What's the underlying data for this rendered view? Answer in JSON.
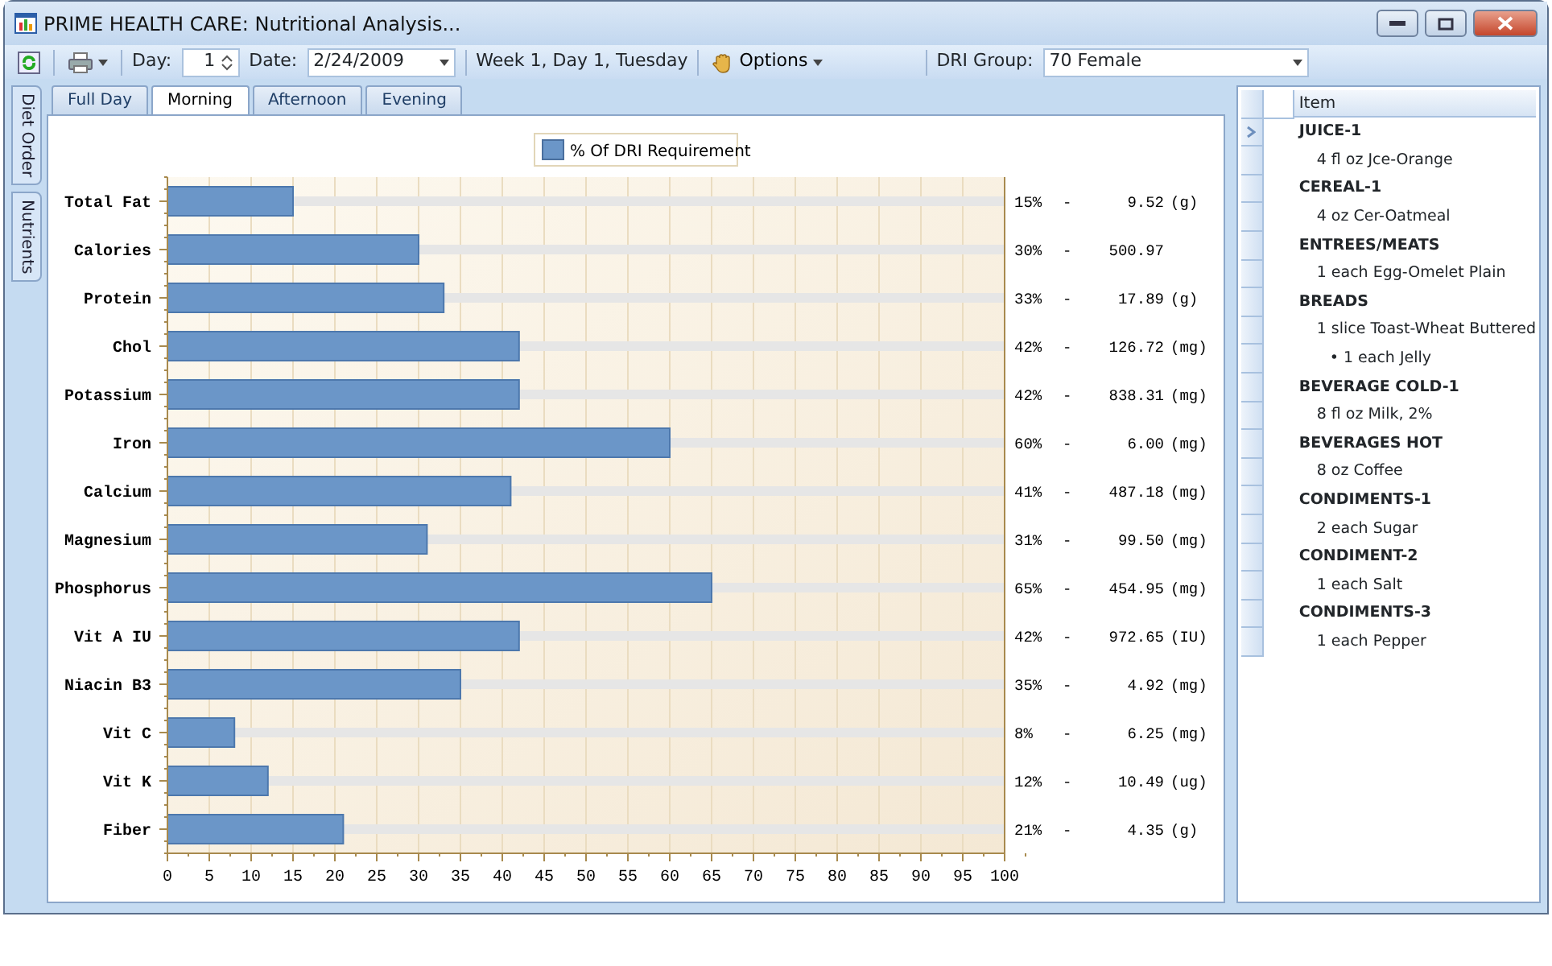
{
  "window": {
    "title": "PRIME HEALTH CARE: Nutritional Analysis..."
  },
  "toolbar": {
    "day_label": "Day:",
    "day_value": "1",
    "date_label": "Date:",
    "date_value": "2/24/2009",
    "week_text": "Week 1, Day 1, Tuesday",
    "options_label": "Options",
    "dri_label": "DRI Group:",
    "dri_value": "70 Female"
  },
  "side_tabs": [
    {
      "label": "Diet Order"
    },
    {
      "label": "Nutrients"
    }
  ],
  "tabs": [
    {
      "label": "Full Day",
      "selected": false
    },
    {
      "label": "Morning",
      "selected": true
    },
    {
      "label": "Afternoon",
      "selected": false
    },
    {
      "label": "Evening",
      "selected": false
    }
  ],
  "chart": {
    "chart_data": {
      "type": "bar",
      "orientation": "horizontal",
      "series": [
        {
          "name": "% Of DRI Requirement",
          "color": "#6b96c8",
          "values": [
            15,
            30,
            33,
            42,
            42,
            60,
            41,
            31,
            65,
            42,
            35,
            8,
            12,
            21
          ]
        },
        {
          "color": "#e6e6e6",
          "values": [
            85,
            70,
            67,
            58,
            58,
            40,
            59,
            69,
            35,
            58,
            65,
            92,
            88,
            79
          ]
        }
      ],
      "stacked": true,
      "categories": [
        "Total Fat",
        "Calories",
        "Protein",
        "Chol",
        "Potassium",
        "Iron",
        "Calcium",
        "Magnesium",
        "Phosphorus",
        "Vit A IU",
        "Niacin B3",
        "Vit C",
        "Vit K",
        "Fiber"
      ],
      "grid": true,
      "xlim": [
        0,
        100
      ],
      "xticks": [
        0,
        5,
        10,
        15,
        20,
        25,
        30,
        35,
        40,
        45,
        50,
        55,
        60,
        65,
        70,
        75,
        80,
        85,
        90,
        95,
        100
      ]
    },
    "readings": [
      {
        "percent": "15%",
        "dash": "-",
        "amount": "9.52",
        "unit": "(g)"
      },
      {
        "percent": "30%",
        "dash": "-",
        "amount": "500.97"
      },
      {
        "percent": "33%",
        "dash": "-",
        "amount": "17.89",
        "unit": "(g)"
      },
      {
        "percent": "42%",
        "dash": "-",
        "amount": "126.72",
        "unit": "(mg)"
      },
      {
        "percent": "42%",
        "dash": "-",
        "amount": "838.31",
        "unit": "(mg)"
      },
      {
        "percent": "60%",
        "dash": "-",
        "amount": "6.00",
        "unit": "(mg)"
      },
      {
        "percent": "41%",
        "dash": "-",
        "amount": "487.18",
        "unit": "(mg)"
      },
      {
        "percent": "31%",
        "dash": "-",
        "amount": "99.50",
        "unit": "(mg)"
      },
      {
        "percent": "65%",
        "dash": "-",
        "amount": "454.95",
        "unit": "(mg)"
      },
      {
        "percent": "42%",
        "dash": "-",
        "amount": "972.65",
        "unit": "(IU)"
      },
      {
        "percent": "35%",
        "dash": "-",
        "amount": "4.92",
        "unit": "(mg)"
      },
      {
        "percent": "8%",
        "dash": "-",
        "amount": "6.25",
        "unit": "(mg)"
      },
      {
        "percent": "12%",
        "dash": "-",
        "amount": "10.49",
        "unit": "(ug)"
      },
      {
        "percent": "21%",
        "dash": "-",
        "amount": "4.35",
        "unit": "(g)"
      }
    ]
  },
  "grid": {
    "column": "Item",
    "rows": [
      {
        "kind": "group",
        "text": "JUICE-1",
        "selected": true
      },
      {
        "kind": "item",
        "text": "4 fl oz Jce-Orange",
        "selected": false
      },
      {
        "kind": "group",
        "text": "CEREAL-1",
        "selected": false
      },
      {
        "kind": "item",
        "text": "4 oz Cer-Oatmeal",
        "selected": false
      },
      {
        "kind": "group",
        "text": "ENTREES/MEATS",
        "selected": false
      },
      {
        "kind": "item",
        "text": "1 each Egg-Omelet Plain",
        "selected": false
      },
      {
        "kind": "group",
        "text": "BREADS",
        "selected": false
      },
      {
        "kind": "item",
        "text": "1 slice Toast-Wheat Buttered",
        "selected": false
      },
      {
        "kind": "subitem",
        "text": "• 1 each Jelly",
        "selected": false
      },
      {
        "kind": "group",
        "text": "BEVERAGE COLD-1",
        "selected": false
      },
      {
        "kind": "item",
        "text": "8 fl oz Milk, 2%",
        "selected": false
      },
      {
        "kind": "group",
        "text": "BEVERAGES HOT",
        "selected": false
      },
      {
        "kind": "item",
        "text": "8 oz Coffee",
        "selected": false
      },
      {
        "kind": "group",
        "text": "CONDIMENTS-1",
        "selected": false
      },
      {
        "kind": "item",
        "text": "2 each Sugar",
        "selected": false
      },
      {
        "kind": "group",
        "text": "CONDIMENT-2",
        "selected": false
      },
      {
        "kind": "item",
        "text": "1 each Salt",
        "selected": false
      },
      {
        "kind": "group",
        "text": "CONDIMENTS-3",
        "selected": false
      },
      {
        "kind": "item",
        "text": "1 each Pepper",
        "selected": false
      }
    ]
  }
}
